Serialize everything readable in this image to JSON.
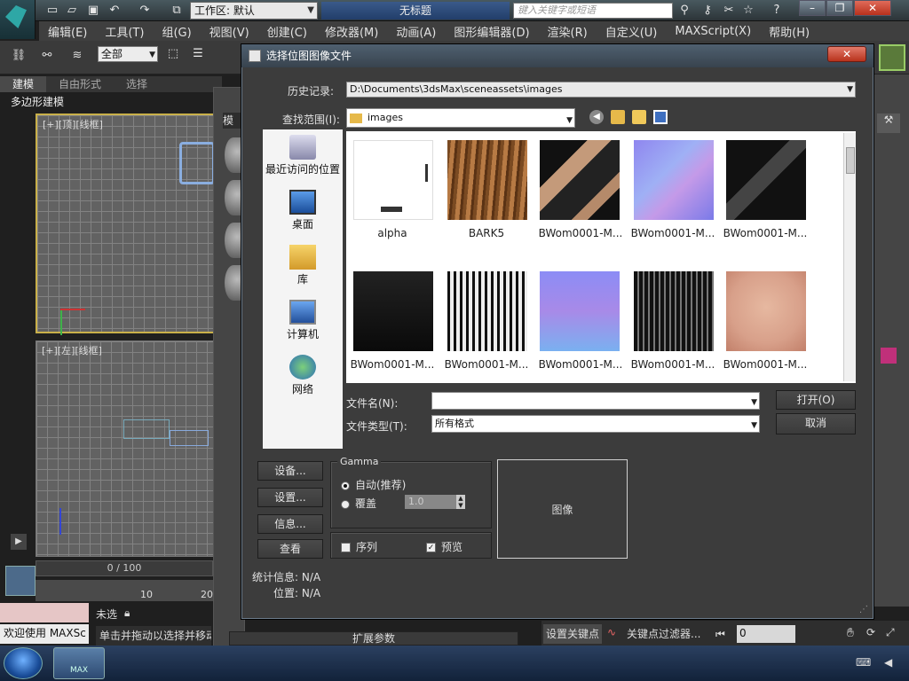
{
  "app": {
    "workspace_label": "工作区: 默认",
    "doc_title": "无标题",
    "search_placeholder": "键入关键字或短语"
  },
  "menu": [
    "编辑(E)",
    "工具(T)",
    "组(G)",
    "视图(V)",
    "创建(C)",
    "修改器(M)",
    "动画(A)",
    "图形编辑器(D)",
    "渲染(R)",
    "自定义(U)",
    "MAXScript(X)",
    "帮助(H)"
  ],
  "toolbar": {
    "selection_filter": "全部"
  },
  "ribbon_tabs": [
    "建模",
    "自由形式",
    "选择"
  ],
  "ribbon_panel": "多边形建模",
  "viewports": {
    "top_label": "[+][顶][线框]",
    "left_label": "[+][左][线框]"
  },
  "timeline": {
    "frame_display": "0 / 100",
    "tick_10": "10",
    "tick_20": "20"
  },
  "status": {
    "welcome": "欢迎使用 MAXSc",
    "hint": "单击并拖动以选择并移动",
    "unsel": "未选"
  },
  "animation": {
    "set_key": "设置关键点",
    "key_filters": "关键点过滤器...",
    "frame_value": "0"
  },
  "material_editor": {
    "title": "模"
  },
  "taskbar": {
    "max_label": "MAX"
  },
  "dialog": {
    "title": "选择位图图像文件",
    "history_label": "历史记录:",
    "history_value": "D:\\Documents\\3dsMax\\sceneassets\\images",
    "lookin_label": "查找范围(I):",
    "lookin_value": "images",
    "places": [
      {
        "label": "最近访问的位置"
      },
      {
        "label": "桌面"
      },
      {
        "label": "库"
      },
      {
        "label": "计算机"
      },
      {
        "label": "网络"
      }
    ],
    "files": [
      {
        "name": "alpha"
      },
      {
        "name": "BARK5"
      },
      {
        "name": "BWom0001-M..."
      },
      {
        "name": "BWom0001-M..."
      },
      {
        "name": "BWom0001-M..."
      },
      {
        "name": "BWom0001-M..."
      },
      {
        "name": "BWom0001-M..."
      },
      {
        "name": "BWom0001-M..."
      },
      {
        "name": "BWom0001-M..."
      },
      {
        "name": "BWom0001-M..."
      }
    ],
    "filename_label": "文件名(N):",
    "filename_value": "",
    "filetype_label": "文件类型(T):",
    "filetype_value": "所有格式",
    "open_button": "打开(O)",
    "cancel_button": "取消",
    "setup_button": "设备...",
    "settings_button": "设置...",
    "info_button": "信息...",
    "view_button": "查看",
    "gamma_title": "Gamma",
    "gamma_auto": "自动(推荐)",
    "gamma_override": "覆盖",
    "gamma_value": "1.0",
    "sequence_label": "序列",
    "preview_label": "预览",
    "preview_area_label": "图像",
    "stats_label": "统计信息: N/A",
    "location_label": "位置: N/A",
    "expand_params": "扩展参数"
  }
}
